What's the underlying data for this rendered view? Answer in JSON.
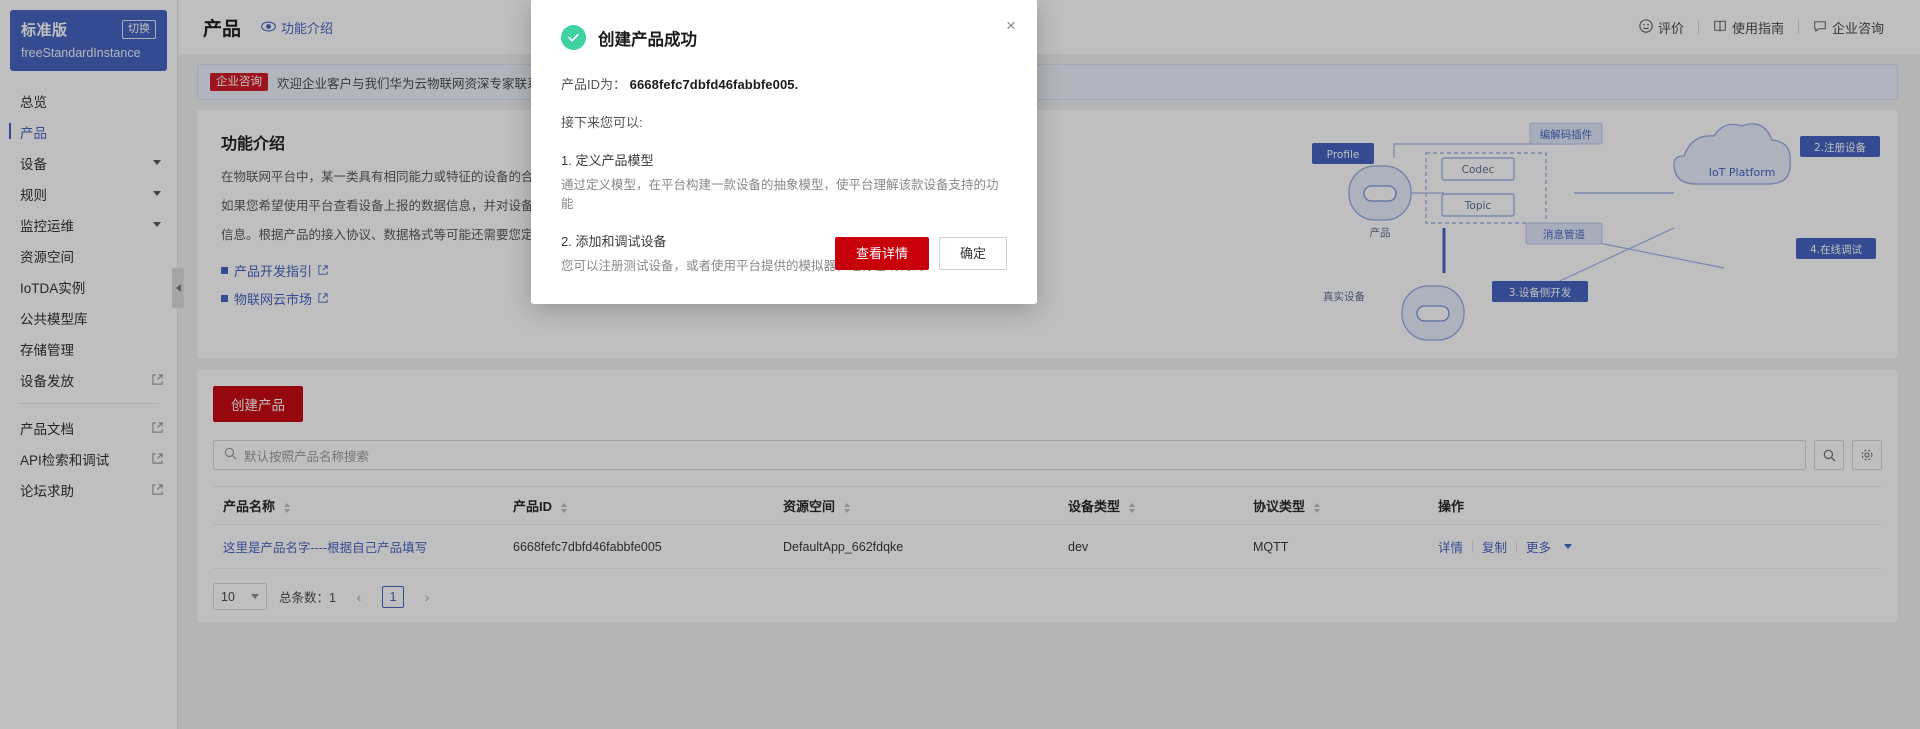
{
  "sidebar": {
    "instance": {
      "edition": "标准版",
      "switch_label": "切换",
      "name": "freeStandardInstance"
    },
    "items": [
      {
        "label": "总览",
        "type": "link"
      },
      {
        "label": "产品",
        "type": "link",
        "active": true
      },
      {
        "label": "设备",
        "type": "group"
      },
      {
        "label": "规则",
        "type": "group"
      },
      {
        "label": "监控运维",
        "type": "group"
      },
      {
        "label": "资源空间",
        "type": "link"
      },
      {
        "label": "IoTDA实例",
        "type": "link"
      },
      {
        "label": "公共模型库",
        "type": "link"
      },
      {
        "label": "存储管理",
        "type": "link"
      },
      {
        "label": "设备发放",
        "type": "external"
      },
      {
        "label": "产品文档",
        "type": "external"
      },
      {
        "label": "API检索和调试",
        "type": "external"
      },
      {
        "label": "论坛求助",
        "type": "external"
      }
    ]
  },
  "header": {
    "title": "产品",
    "intro_link": "功能介绍",
    "right_items": [
      "评价",
      "使用指南",
      "企业咨询"
    ]
  },
  "banner": {
    "tag": "企业咨询",
    "text": "欢迎企业客户与我们华为云物联网资深专家联系，定制"
  },
  "feature": {
    "title": "功能介绍",
    "paragraphs": [
      "在物联网平台中，某一类具有相同能力或特征的设备的合集被称为",
      "如果您希望使用平台查看设备上报的数据信息，并对设备进行管理，还需要您定义其他相",
      "信息。根据产品的接入协议、数据格式等可能还需要您定义其他相"
    ],
    "links": [
      "产品开发指引",
      "物联网云市场"
    ],
    "diagram_labels": [
      "编解码插件",
      "Profile",
      "Codec",
      "Topic",
      "产品",
      "消息管道",
      "IoT Platform",
      "真实设备",
      "2.注册设备",
      "4.在线调试",
      "3.设备侧开发"
    ]
  },
  "table_card": {
    "create_button": "创建产品",
    "search_placeholder": "默认按照产品名称搜索",
    "columns": [
      "产品名称",
      "产品ID",
      "资源空间",
      "设备类型",
      "协议类型",
      "操作"
    ],
    "rows": [
      {
        "name": "这里是产品名字----根据自己产品填写",
        "id": "6668fefc7dbfd46fabbfe005",
        "space": "DefaultApp_662fdqke",
        "device_type": "dev",
        "protocol": "MQTT",
        "ops": [
          "详情",
          "复制",
          "更多"
        ]
      }
    ],
    "pager": {
      "page_size": "10",
      "total_label": "总条数：",
      "total": "1",
      "current_page": "1"
    }
  },
  "modal": {
    "title": "创建产品成功",
    "id_label": "产品ID为：",
    "product_id": "6668fefc7dbfd46fabbfe005.",
    "next_label": "接下来您可以:",
    "steps": [
      {
        "title": "1. 定义产品模型",
        "desc": "通过定义模型，在平台构建一款设备的抽象模型，使平台理解该款设备支持的功能"
      },
      {
        "title": "2. 添加和调试设备",
        "desc": "您可以注册测试设备，或者使用平台提供的模拟器，进行在线调试"
      }
    ],
    "primary_button": "查看详情",
    "default_button": "确定",
    "close_icon": "×"
  },
  "colors": {
    "accent": "#3f5fc0",
    "danger": "#c7000b",
    "success": "#3fd1a0"
  }
}
